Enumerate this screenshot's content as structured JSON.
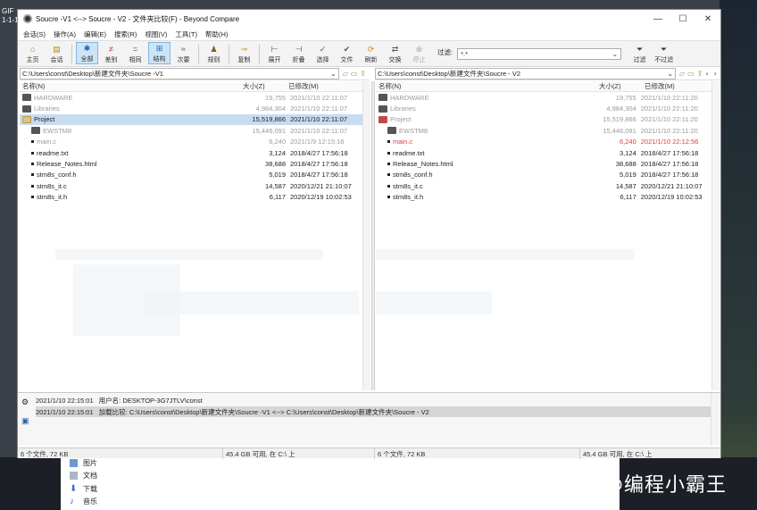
{
  "gif_tag": [
    "GIF",
    "1-1-1"
  ],
  "window": {
    "title": "Soucre -V1 <--> Soucre - V2 - 文件夹比较(F) - Beyond Compare",
    "minimize": "—",
    "maximize": "☐",
    "close": "✕"
  },
  "menu": [
    "会话(S)",
    "操作(A)",
    "编辑(E)",
    "搜索(R)",
    "视图(V)",
    "工具(T)",
    "帮助(H)"
  ],
  "toolbar": {
    "buttons": [
      {
        "label": "主页",
        "icon": "home-icon",
        "glyph": "⌂"
      },
      {
        "label": "会话",
        "icon": "session-icon",
        "glyph": "▤"
      },
      {
        "label": "全部",
        "icon": "all-icon",
        "glyph": "✱"
      },
      {
        "label": "差别",
        "icon": "diff-icon",
        "glyph": "≠"
      },
      {
        "label": "相同",
        "icon": "same-icon",
        "glyph": "="
      },
      {
        "label": "结构",
        "icon": "structure-icon",
        "glyph": "⊞"
      },
      {
        "label": "次要",
        "icon": "minor-icon",
        "glyph": "≈"
      },
      {
        "label": "规则",
        "icon": "rules-icon",
        "glyph": "♟"
      },
      {
        "label": "复制",
        "icon": "copy-icon",
        "glyph": "⇒"
      },
      {
        "label": "展开",
        "icon": "expand-icon",
        "glyph": "⊢"
      },
      {
        "label": "折叠",
        "icon": "collapse-icon",
        "glyph": "⊣"
      },
      {
        "label": "选择",
        "icon": "select-icon",
        "glyph": "✓"
      },
      {
        "label": "文件",
        "icon": "files-icon",
        "glyph": "✔"
      },
      {
        "label": "刷新",
        "icon": "refresh-icon",
        "glyph": "⟳"
      },
      {
        "label": "交换",
        "icon": "swap-icon",
        "glyph": "⇄"
      },
      {
        "label": "停止",
        "icon": "stop-icon",
        "glyph": "⊗"
      }
    ],
    "filter_label": "过滤:",
    "filter_value": "*.*",
    "filter_button": "过滤",
    "nofilter_button": "不过滤"
  },
  "left": {
    "path": "C:\\Users\\const\\Desktop\\新建文件夹\\Soucre -V1",
    "headers": {
      "name": "名称(N)",
      "size": "大小(Z)",
      "date": "已修改(M)"
    },
    "rows": [
      {
        "name": "HARDWARE",
        "size": "19,755",
        "date": "2021/1/10 22:11:07",
        "kind": "folder",
        "style": "dim"
      },
      {
        "name": "Libraries",
        "size": "4,984,304",
        "date": "2021/1/10 22:11:07",
        "kind": "folder",
        "style": "dim"
      },
      {
        "name": "Project",
        "size": "15,519,866",
        "date": "2021/1/10 22:11:07",
        "kind": "folder-open",
        "style": "sel"
      },
      {
        "name": "EWSTM8",
        "size": "15,446,091",
        "date": "2021/1/10 22:11:07",
        "kind": "folder",
        "style": "dim",
        "indent": 1
      },
      {
        "name": "main.c",
        "size": "6,240",
        "date": "2021/1/9 12:15:16",
        "kind": "file",
        "style": "dim",
        "indent": 1
      },
      {
        "name": "readme.txt",
        "size": "3,124",
        "date": "2018/4/27 17:56:18",
        "kind": "file",
        "style": "",
        "indent": 1
      },
      {
        "name": "Release_Notes.html",
        "size": "38,688",
        "date": "2018/4/27 17:56:18",
        "kind": "file",
        "style": "",
        "indent": 1
      },
      {
        "name": "stm8s_conf.h",
        "size": "5,019",
        "date": "2018/4/27 17:56:18",
        "kind": "file",
        "style": "",
        "indent": 1
      },
      {
        "name": "stm8s_it.c",
        "size": "14,587",
        "date": "2020/12/21 21:10:07",
        "kind": "file",
        "style": "",
        "indent": 1
      },
      {
        "name": "stm8s_it.h",
        "size": "6,117",
        "date": "2020/12/19 10:02:53",
        "kind": "file",
        "style": "",
        "indent": 1
      }
    ]
  },
  "right": {
    "path": "C:\\Users\\const\\Desktop\\新建文件夹\\Soucre - V2",
    "headers": {
      "name": "名称(N)",
      "size": "大小(Z)",
      "date": "已修改(M)"
    },
    "rows": [
      {
        "name": "HARDWARE",
        "size": "19,755",
        "date": "2021/1/10 22:11:20",
        "kind": "folder",
        "style": "dim"
      },
      {
        "name": "Libraries",
        "size": "4,984,304",
        "date": "2021/1/10 22:11:20",
        "kind": "folder",
        "style": "dim"
      },
      {
        "name": "Project",
        "size": "15,519,866",
        "date": "2021/1/10 22:11:20",
        "kind": "folder-red",
        "style": "dim"
      },
      {
        "name": "EWSTM8",
        "size": "15,446,091",
        "date": "2021/1/10 22:11:20",
        "kind": "folder",
        "style": "dim",
        "indent": 1
      },
      {
        "name": "main.c",
        "size": "6,240",
        "date": "2021/1/10 22:12:56",
        "kind": "file",
        "style": "red",
        "indent": 1
      },
      {
        "name": "readme.txt",
        "size": "3,124",
        "date": "2018/4/27 17:56:18",
        "kind": "file",
        "style": "",
        "indent": 1
      },
      {
        "name": "Release_Notes.html",
        "size": "38,688",
        "date": "2018/4/27 17:56:18",
        "kind": "file",
        "style": "",
        "indent": 1
      },
      {
        "name": "stm8s_conf.h",
        "size": "5,019",
        "date": "2018/4/27 17:56:18",
        "kind": "file",
        "style": "",
        "indent": 1
      },
      {
        "name": "stm8s_it.c",
        "size": "14,587",
        "date": "2020/12/21 21:10:07",
        "kind": "file",
        "style": "",
        "indent": 1
      },
      {
        "name": "stm8s_it.h",
        "size": "6,117",
        "date": "2020/12/19 10:02:53",
        "kind": "file",
        "style": "",
        "indent": 1
      }
    ]
  },
  "log": [
    {
      "time": "2021/1/10 22:15:01",
      "text": "用户名:   DESKTOP-3G7JTLV\\const"
    },
    {
      "time": "2021/1/10 22:15:01",
      "text": "加载比较:   C:\\Users\\const\\Desktop\\新建文件夹\\Soucre -V1 <--> C:\\Users\\const\\Desktop\\新建文件夹\\Soucre - V2"
    }
  ],
  "status": {
    "left_files": "6 个文件, 72 KB",
    "left_disk": "45.4 GB 可用, 在 C:\\ 上",
    "right_files": "6 个文件, 72 KB",
    "right_disk": "45.4 GB 可用, 在 C:\\ 上"
  },
  "explorer": [
    "图片",
    "文档",
    "下载",
    "音乐"
  ],
  "watermark": "知乎 @编程小霸王"
}
